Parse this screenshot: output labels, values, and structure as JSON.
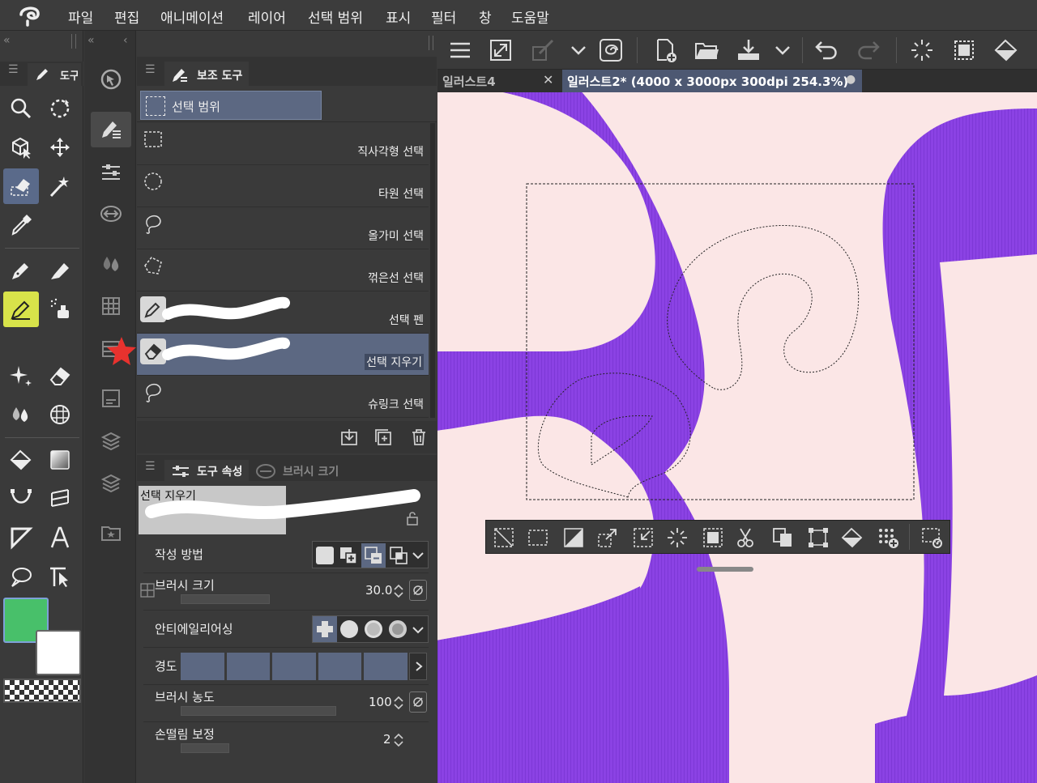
{
  "menu": {
    "items": [
      "파일",
      "편집",
      "애니메이션",
      "레이어",
      "선택 범위",
      "표시",
      "필터",
      "창",
      "도움말"
    ]
  },
  "left_panel": {
    "tab_label": "도구"
  },
  "subtool_panel": {
    "tab_label": "보조 도구",
    "group_label": "선택 범위",
    "items": [
      {
        "label": "직사각형 선택",
        "icon": "rect-select-icon"
      },
      {
        "label": "타원 선택",
        "icon": "ellipse-select-icon"
      },
      {
        "label": "올가미 선택",
        "icon": "lasso-icon"
      },
      {
        "label": "꺾은선 선택",
        "icon": "polyline-select-icon"
      },
      {
        "label": "선택 펜",
        "icon": "selection-pen-icon"
      },
      {
        "label": "선택 지우기",
        "icon": "selection-eraser-icon"
      },
      {
        "label": "슈링크 선택",
        "icon": "shrink-select-icon"
      }
    ],
    "selected_index": 5
  },
  "tool_property": {
    "tab_label": "도구 속성",
    "tab2_label": "브러시 크기",
    "preview_label": "선택 지우기",
    "rows": {
      "drawing_method": "작성 방법",
      "brush_size": "브러시 크기",
      "brush_size_value": "30.0",
      "antialiasing": "안티에일리어싱",
      "hardness": "경도",
      "brush_density": "브러시 농도",
      "brush_density_value": "100",
      "stabilization": "손떨림 보정",
      "stabilization_value": "2"
    }
  },
  "document_tabs": [
    {
      "label": "일러스트4",
      "active": false
    },
    {
      "label": "일러스트2* (4000 x 3000px 300dpi 254.3%)",
      "active": true
    }
  ],
  "colors": {
    "main_color": "#48c06a",
    "sub_color": "#ffffff",
    "canvas_bg": "#fbe6e6",
    "stroke": "#8a3fe6",
    "accent": "#5c6882"
  }
}
